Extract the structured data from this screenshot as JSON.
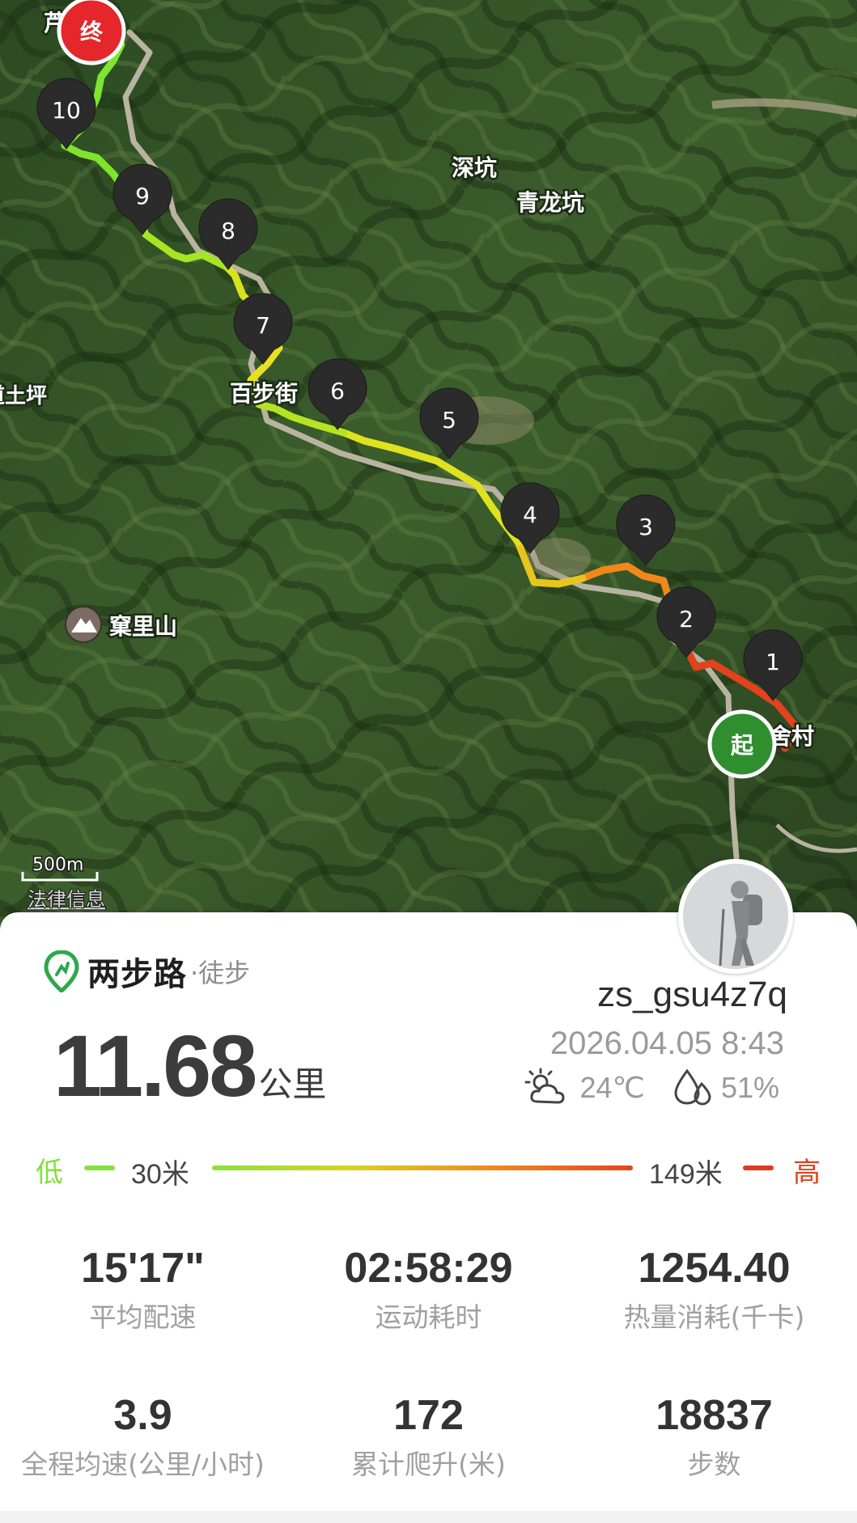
{
  "map": {
    "places": [
      "深坑",
      "青龙坑",
      "百步街",
      "窠里山",
      "道土坪",
      "舍村",
      "芦"
    ],
    "scale": "500m",
    "legal": "法律信息",
    "start_label": "起",
    "end_label": "终",
    "waypoints": [
      "1",
      "2",
      "3",
      "4",
      "5",
      "6",
      "7",
      "8",
      "9",
      "10"
    ]
  },
  "brand": {
    "name": "两步路",
    "sub": "·徒步"
  },
  "user": {
    "name": "zs_gsu4z7q",
    "datetime": "2026.04.05 8:43"
  },
  "weather": {
    "temp": "24℃",
    "humidity": "51%",
    "weather_icon": "partly-cloudy-icon",
    "humidity_icon": "water-drops-icon"
  },
  "distance": {
    "value": "11.68",
    "unit": "公里"
  },
  "elevation": {
    "low_label": "低",
    "high_label": "高",
    "min": "30米",
    "max": "149米",
    "low_color": "#86e23a",
    "high_color": "#e03a1f"
  },
  "stats": [
    {
      "value": "15'17\"",
      "label": "平均配速"
    },
    {
      "value": "02:58:29",
      "label": "运动耗时"
    },
    {
      "value": "1254.40",
      "label": "热量消耗(千卡)"
    },
    {
      "value": "3.9",
      "label": "全程均速(公里/小时)"
    },
    {
      "value": "172",
      "label": "累计爬升(米)"
    },
    {
      "value": "18837",
      "label": "步数"
    }
  ]
}
